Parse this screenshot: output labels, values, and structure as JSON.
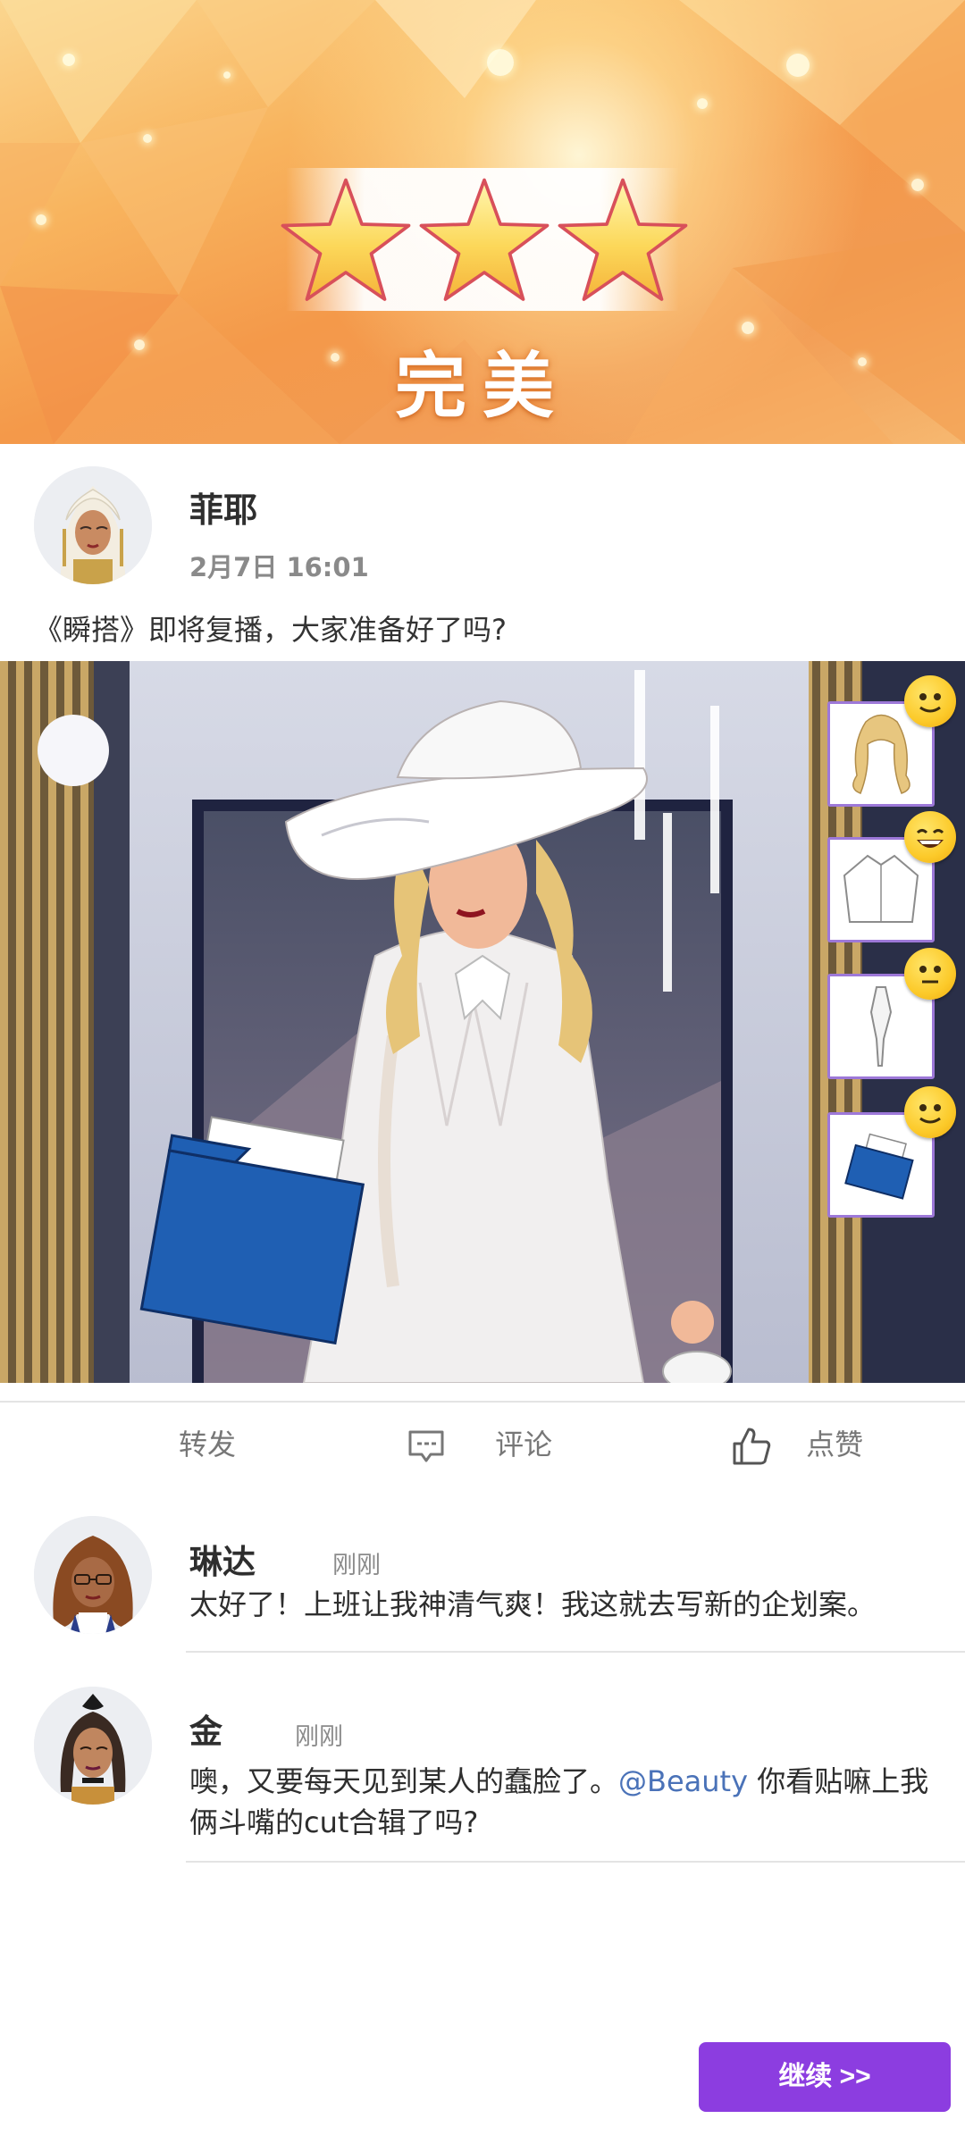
{
  "banner": {
    "stars_earned": 3,
    "stars_total": 3,
    "rating_text": "完美"
  },
  "post": {
    "author": "菲耶",
    "time": "2月7日 16:01",
    "text": "《瞬搭》即将复播，大家准备好了吗?",
    "outfit_items": [
      "hair",
      "blouse",
      "necktie",
      "folder"
    ]
  },
  "actions": {
    "share_label": "转发",
    "comment_label": "评论",
    "like_label": "点赞"
  },
  "comments": [
    {
      "name": "琳达",
      "time": "刚刚",
      "text": "太好了！上班让我神清气爽！我这就去写新的企划案。"
    },
    {
      "name": "金",
      "time": "刚刚",
      "text_before": "噢，又要每天见到某人的蠢脸了。",
      "mention": "@Beauty",
      "text_after_line1": " 你看贴嘛上我",
      "text_line2": "俩斗嘴的cut合辑了吗?"
    }
  ],
  "continue_label": "继续 >>",
  "colors": {
    "accent_purple": "#8c3de0",
    "mention_blue": "#4a72b8",
    "card_border": "#9d78d8",
    "banner_orange": "#f4994a"
  }
}
